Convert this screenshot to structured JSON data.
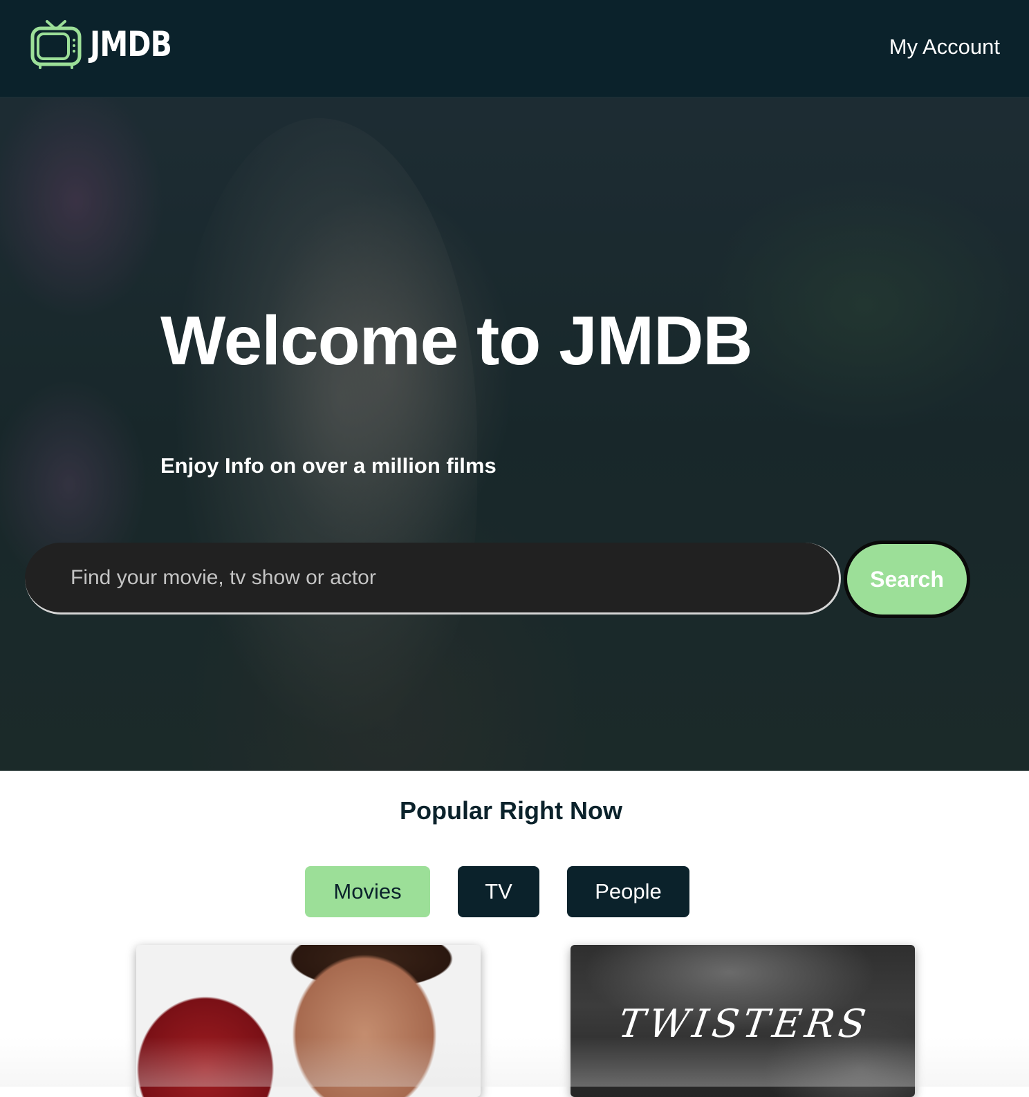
{
  "header": {
    "logo_text": "JMDB",
    "account_label": "My Account"
  },
  "hero": {
    "title": "Welcome to JMDB",
    "subtitle": "Enjoy Info on over a million films",
    "search_placeholder": "Find your movie, tv show or actor",
    "search_value": "",
    "search_button_label": "Search"
  },
  "popular": {
    "title": "Popular Right Now",
    "tabs": [
      {
        "label": "Movies",
        "active": true
      },
      {
        "label": "TV",
        "active": false
      },
      {
        "label": "People",
        "active": false
      }
    ],
    "posters": [
      {
        "logo_text": ""
      },
      {
        "logo_text": "TWISTERS"
      }
    ]
  },
  "icons": {
    "logo": "tv-icon"
  },
  "colors": {
    "header_bg": "#0b222b",
    "accent_green": "#9cdf98",
    "search_bg": "#212121",
    "text_dark": "#0b222b"
  }
}
